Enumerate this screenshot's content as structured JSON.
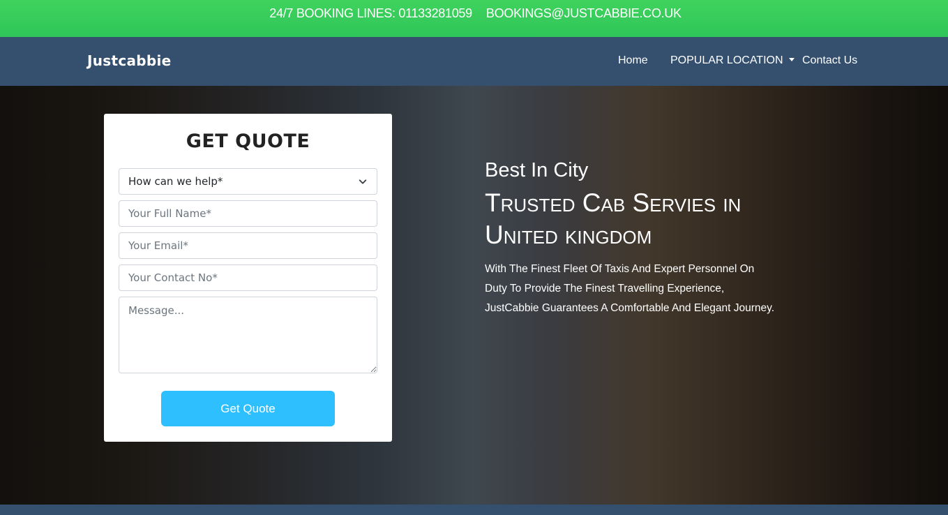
{
  "topbar": {
    "phone": "24/7 BOOKING LINES: 01133281059",
    "email": "BOOKINGS@JUSTCABBIE.CO.UK"
  },
  "nav": {
    "brand": "Justcabbie",
    "home": "Home",
    "popular": "POPULAR LOCATION",
    "contact": "Contact Us"
  },
  "quote": {
    "title": "GET QUOTE",
    "select_value": "How can we help*",
    "name_placeholder": "Your Full Name*",
    "email_placeholder": "Your Email*",
    "contact_placeholder": "Your Contact No*",
    "message_placeholder": "Message...",
    "button": "Get Quote"
  },
  "hero": {
    "tagline": "Best In City",
    "headline": "Trusted Cab Servies in United kingdom",
    "blurb": "With The Finest Fleet Of Taxis And Expert Personnel On Duty To Provide The Finest Travelling Experience, JustCabbie Guarantees A Comfortable And Elegant Journey."
  },
  "colors": {
    "topbar": "#34c759",
    "navbar": "#34506e",
    "button": "#2ebfff"
  }
}
